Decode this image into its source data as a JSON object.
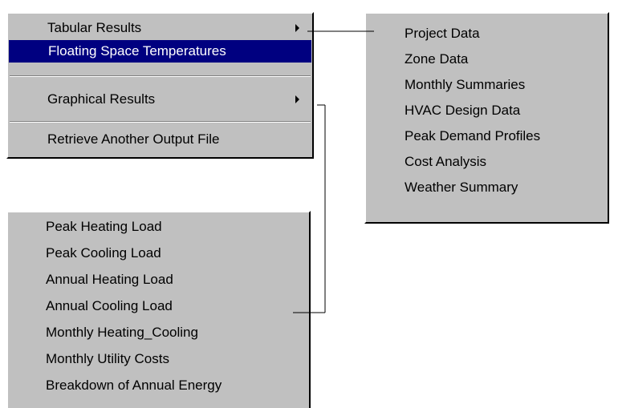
{
  "main_menu": {
    "items": [
      {
        "label": "Tabular Results",
        "has_submenu": true
      },
      {
        "label": "Floating Space Temperatures",
        "selected": true
      },
      {
        "label": "Graphical Results",
        "has_submenu": true
      },
      {
        "label": "Retrieve Another Output File"
      }
    ]
  },
  "tabular_submenu": {
    "items": [
      "Project Data",
      "Zone Data",
      "Monthly Summaries",
      "HVAC Design Data",
      "Peak Demand Profiles",
      "Cost Analysis",
      "Weather Summary"
    ]
  },
  "graphical_submenu": {
    "items": [
      "Peak Heating Load",
      "Peak Cooling Load",
      "Annual Heating Load",
      "Annual Cooling Load",
      "Monthly Heating_Cooling",
      "Monthly Utility Costs",
      "Breakdown of Annual Energy"
    ]
  },
  "colors": {
    "menu_face": "#c0c0c0",
    "highlight": "#000080",
    "highlight_text": "#ffffff"
  },
  "icons": {
    "submenu_arrow": "submenu-arrow-icon"
  }
}
